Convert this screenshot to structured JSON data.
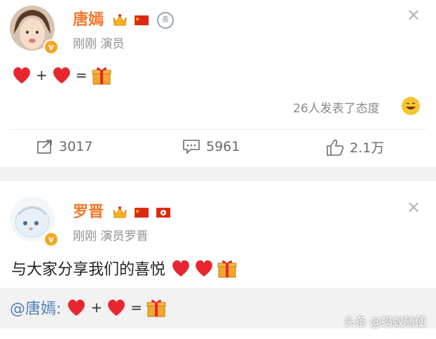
{
  "post1": {
    "author": "唐嫣",
    "meta": "刚刚  演员",
    "badge_v": "v",
    "medal": "善",
    "op_plus": "+",
    "op_eq": "=",
    "attitude_text": "26人发表了态度",
    "actions": {
      "repost": "3017",
      "comment": "5961",
      "like": "2.1万"
    }
  },
  "post2": {
    "author": "罗晋",
    "meta": "刚刚  演员罗晋",
    "badge_v": "v",
    "text": "与大家分享我们的喜悦",
    "retweet_mention": "@唐嫣:",
    "op_plus": "+",
    "op_eq": "="
  },
  "watermark": "头条 @蚂蚁随便",
  "colors": {
    "name": "#f3762a",
    "link": "#4e7fb9",
    "heart": "#e8262f",
    "gift": "#f4a72a"
  }
}
